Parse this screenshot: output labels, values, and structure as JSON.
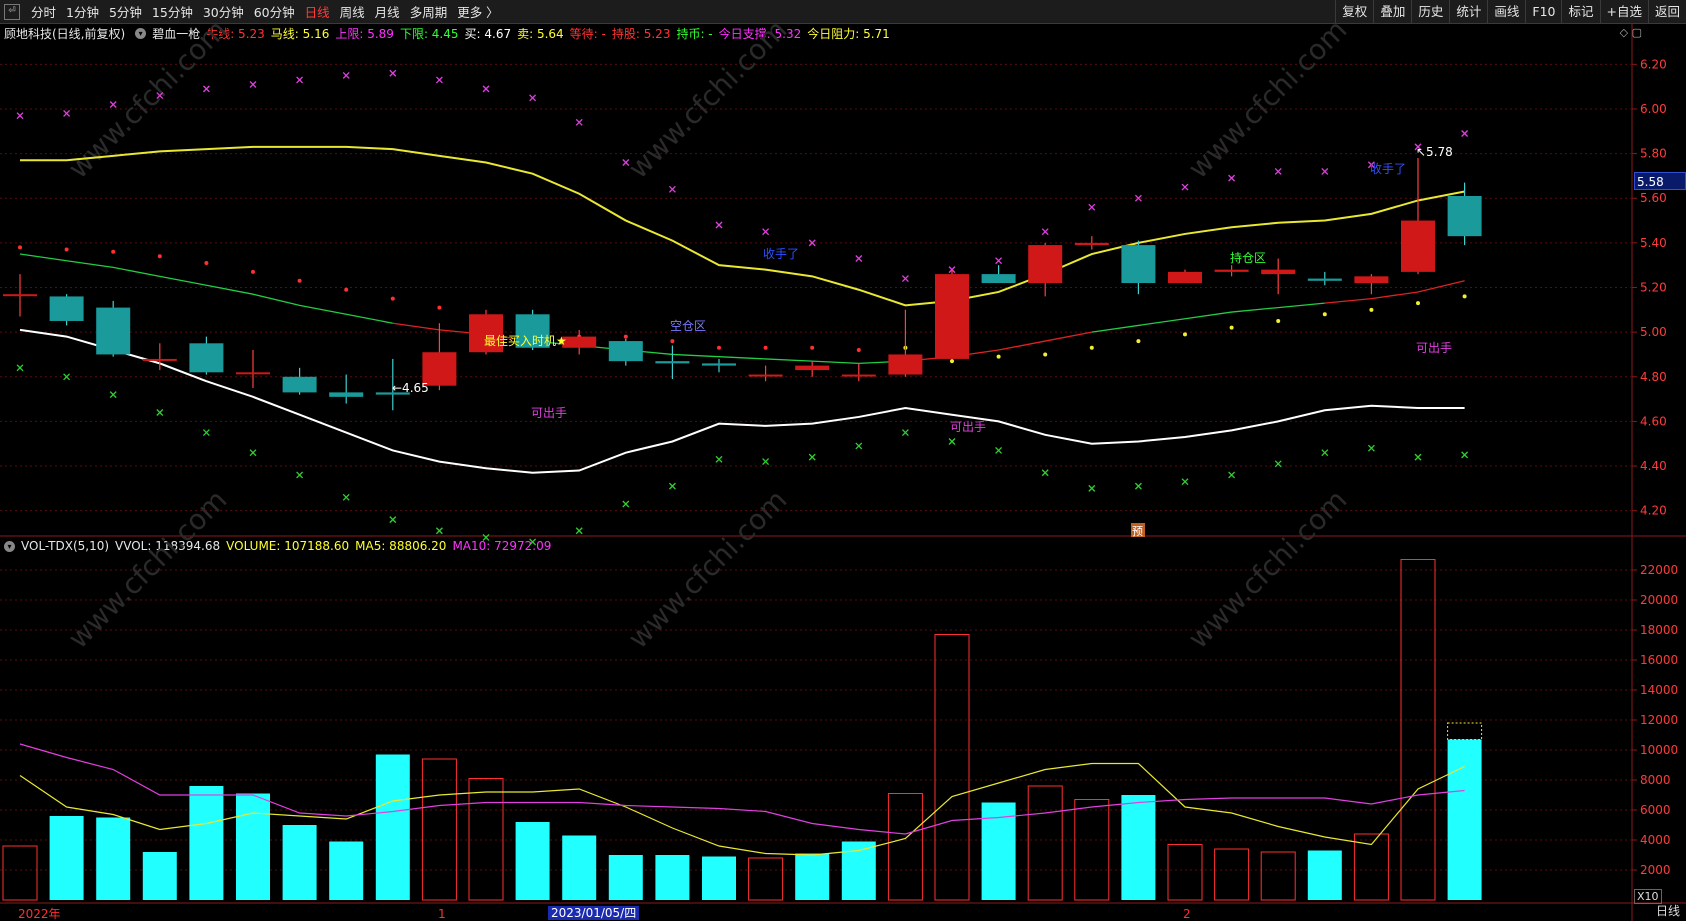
{
  "toolbar": {
    "left_items": [
      "分时",
      "1分钟",
      "5分钟",
      "15分钟",
      "30分钟",
      "60分钟",
      "日线",
      "周线",
      "月线",
      "多周期",
      "更多 〉"
    ],
    "active_index": 6,
    "right_items": [
      "复权",
      "叠加",
      "历史",
      "统计",
      "画线",
      "F10",
      "标记",
      "+自选",
      "返回"
    ]
  },
  "info": {
    "stock": "顾地科技(日线,前复权)",
    "indicator": "碧血一枪",
    "fields": [
      {
        "label": "牛线:",
        "value": "5.23",
        "color": "#ff3333"
      },
      {
        "label": "马线:",
        "value": "5.16",
        "color": "#ffff33"
      },
      {
        "label": "上限:",
        "value": "5.89",
        "color": "#ff33ff"
      },
      {
        "label": "下限:",
        "value": "4.45",
        "color": "#33ff33"
      },
      {
        "label": "买:",
        "value": "4.67",
        "color": "#ffffff"
      },
      {
        "label": "卖:",
        "value": "5.64",
        "color": "#ffff33"
      },
      {
        "label": "等待:",
        "value": "-",
        "color": "#ff3333"
      },
      {
        "label": "持股:",
        "value": "5.23",
        "color": "#ff3333"
      },
      {
        "label": "持币:",
        "value": "-",
        "color": "#33ff33"
      },
      {
        "label": "今日支撑:",
        "value": "5.32",
        "color": "#ff33ff"
      },
      {
        "label": "今日阻力:",
        "value": "5.71",
        "color": "#ffff33"
      }
    ]
  },
  "price_axis": [
    "6.20",
    "6.00",
    "5.80",
    "5.60",
    "5.40",
    "5.20",
    "5.00",
    "4.80",
    "4.60",
    "4.40",
    "4.20"
  ],
  "current_price": "5.58",
  "vol": {
    "name": "VOL-TDX(5,10)",
    "vvol": "VVOL: 118394.68",
    "volume": "VOLUME: 107188.60",
    "ma5": "MA5: 88806.20",
    "ma10": "MA10: 72972.09"
  },
  "vol_axis": [
    "22000",
    "20000",
    "18000",
    "16000",
    "14000",
    "12000",
    "10000",
    "8000",
    "6000",
    "4000",
    "2000"
  ],
  "annotations": {
    "low": "←4.65",
    "high": "↖5.78",
    "best_buy": "最佳买入时机★",
    "sell1": "可出手",
    "sell2": "可出手",
    "sell3": "可出手",
    "empty_zone": "空仓区",
    "hold_zone": "持仓区",
    "take_profit": "收手了",
    "take_profit2": "收手了",
    "yu": "预"
  },
  "x_labels": {
    "year": "2022年",
    "m1": "1",
    "m2": "2",
    "date": "2023/01/05/四"
  },
  "period": "日线",
  "x10": "X10",
  "watermark": "www.cfchi.com",
  "chart_data": {
    "type": "candlestick",
    "title": "顾地科技(日线,前复权)",
    "price_ylim": [
      4.1,
      6.3
    ],
    "candles": [
      {
        "o": 5.17,
        "c": 5.17,
        "h": 5.26,
        "l": 5.07
      },
      {
        "o": 5.16,
        "c": 5.05,
        "h": 5.17,
        "l": 5.03
      },
      {
        "o": 5.11,
        "c": 4.9,
        "h": 5.14,
        "l": 4.89
      },
      {
        "o": 4.88,
        "c": 4.88,
        "h": 4.95,
        "l": 4.83
      },
      {
        "o": 4.95,
        "c": 4.82,
        "h": 4.98,
        "l": 4.81
      },
      {
        "o": 4.82,
        "c": 4.82,
        "h": 4.92,
        "l": 4.75
      },
      {
        "o": 4.8,
        "c": 4.73,
        "h": 4.84,
        "l": 4.72
      },
      {
        "o": 4.73,
        "c": 4.71,
        "h": 4.81,
        "l": 4.68
      },
      {
        "o": 4.73,
        "c": 4.72,
        "h": 4.88,
        "l": 4.65
      },
      {
        "o": 4.76,
        "c": 4.91,
        "h": 5.04,
        "l": 4.74
      },
      {
        "o": 4.91,
        "c": 5.08,
        "h": 5.1,
        "l": 4.9
      },
      {
        "o": 5.08,
        "c": 4.93,
        "h": 5.1,
        "l": 4.92
      },
      {
        "o": 4.93,
        "c": 4.98,
        "h": 5.01,
        "l": 4.9
      },
      {
        "o": 4.96,
        "c": 4.87,
        "h": 4.97,
        "l": 4.85
      },
      {
        "o": 4.87,
        "c": 4.86,
        "h": 4.94,
        "l": 4.79
      },
      {
        "o": 4.86,
        "c": 4.85,
        "h": 4.88,
        "l": 4.82
      },
      {
        "o": 4.81,
        "c": 4.81,
        "h": 4.85,
        "l": 4.78
      },
      {
        "o": 4.83,
        "c": 4.85,
        "h": 4.87,
        "l": 4.8
      },
      {
        "o": 4.81,
        "c": 4.81,
        "h": 4.86,
        "l": 4.78
      },
      {
        "o": 4.81,
        "c": 4.9,
        "h": 5.1,
        "l": 4.8
      },
      {
        "o": 4.88,
        "c": 5.26,
        "h": 5.28,
        "l": 4.88
      },
      {
        "o": 5.26,
        "c": 5.22,
        "h": 5.3,
        "l": 5.22
      },
      {
        "o": 5.22,
        "c": 5.39,
        "h": 5.4,
        "l": 5.16
      },
      {
        "o": 5.39,
        "c": 5.4,
        "h": 5.43,
        "l": 5.37
      },
      {
        "o": 5.39,
        "c": 5.22,
        "h": 5.41,
        "l": 5.17
      },
      {
        "o": 5.22,
        "c": 5.27,
        "h": 5.28,
        "l": 5.22
      },
      {
        "o": 5.27,
        "c": 5.28,
        "h": 5.3,
        "l": 5.25
      },
      {
        "o": 5.26,
        "c": 5.28,
        "h": 5.33,
        "l": 5.17
      },
      {
        "o": 5.24,
        "c": 5.23,
        "h": 5.27,
        "l": 5.21
      },
      {
        "o": 5.22,
        "c": 5.25,
        "h": 5.26,
        "l": 5.17
      },
      {
        "o": 5.27,
        "c": 5.5,
        "h": 5.78,
        "l": 5.26
      },
      {
        "o": 5.61,
        "c": 5.43,
        "h": 5.67,
        "l": 5.39
      }
    ],
    "volume_ylim": [
      0,
      23000
    ],
    "volume": [
      3600,
      5600,
      5500,
      3200,
      7600,
      7100,
      5000,
      3900,
      9700,
      9400,
      8100,
      5200,
      4300,
      3000,
      3000,
      2900,
      2800,
      3100,
      3900,
      7100,
      17700,
      6500,
      7600,
      6700,
      7000,
      3700,
      3400,
      3200,
      3300,
      4400,
      22700,
      10700
    ],
    "volume_up": [
      true,
      false,
      false,
      false,
      false,
      false,
      false,
      false,
      false,
      true,
      true,
      false,
      false,
      false,
      false,
      false,
      true,
      false,
      false,
      true,
      true,
      false,
      true,
      true,
      false,
      true,
      true,
      true,
      false,
      true,
      true,
      false
    ],
    "volume_forecast_top": 11800,
    "series": {
      "upper_yellow": [
        5.77,
        5.77,
        5.79,
        5.81,
        5.82,
        5.83,
        5.83,
        5.83,
        5.82,
        5.79,
        5.76,
        5.71,
        5.62,
        5.5,
        5.41,
        5.3,
        5.28,
        5.25,
        5.19,
        5.12,
        5.14,
        5.18,
        5.26,
        5.35,
        5.4,
        5.44,
        5.47,
        5.49,
        5.5,
        5.53,
        5.59,
        5.63
      ],
      "mid_line": [
        5.35,
        5.32,
        5.29,
        5.25,
        5.21,
        5.17,
        5.12,
        5.08,
        5.04,
        5.01,
        4.99,
        4.96,
        4.94,
        4.92,
        4.9,
        4.89,
        4.88,
        4.87,
        4.86,
        4.87,
        4.89,
        4.92,
        4.96,
        5.0,
        5.03,
        5.06,
        5.09,
        5.11,
        5.13,
        5.15,
        5.18,
        5.23
      ],
      "lower_white": [
        5.01,
        4.98,
        4.92,
        4.86,
        4.78,
        4.71,
        4.63,
        4.55,
        4.47,
        4.42,
        4.39,
        4.37,
        4.38,
        4.46,
        4.51,
        4.59,
        4.58,
        4.59,
        4.62,
        4.66,
        4.63,
        4.6,
        4.54,
        4.5,
        4.51,
        4.53,
        4.56,
        4.6,
        4.65,
        4.67,
        4.66,
        4.66
      ],
      "upper_x": [
        5.97,
        5.98,
        6.02,
        6.06,
        6.09,
        6.11,
        6.13,
        6.15,
        6.16,
        6.13,
        6.09,
        6.05,
        5.94,
        5.76,
        5.64,
        5.48,
        5.45,
        5.4,
        5.33,
        5.24,
        5.28,
        5.32,
        5.45,
        5.56,
        5.6,
        5.65,
        5.69,
        5.72,
        5.72,
        5.75,
        5.83,
        5.89
      ],
      "lower_x": [
        4.84,
        4.8,
        4.72,
        4.64,
        4.55,
        4.46,
        4.36,
        4.26,
        4.16,
        4.11,
        4.08,
        4.06,
        4.11,
        4.23,
        4.31,
        4.43,
        4.42,
        4.44,
        4.49,
        4.55,
        4.51,
        4.47,
        4.37,
        4.3,
        4.31,
        4.33,
        4.36,
        4.41,
        4.46,
        4.48,
        4.44,
        4.45
      ],
      "dots": [
        5.38,
        5.37,
        5.36,
        5.34,
        5.31,
        5.27,
        5.23,
        5.19,
        5.15,
        5.11,
        5.07,
        5.02,
        4.98,
        4.98,
        4.96,
        4.93,
        4.93,
        4.93,
        4.92,
        4.93,
        4.87,
        4.89,
        4.9,
        4.93,
        4.96,
        4.99,
        5.02,
        5.05,
        5.08,
        5.1,
        5.13,
        5.16
      ],
      "vol_ma5": [
        8300,
        6200,
        5700,
        4700,
        5100,
        5800,
        5600,
        5400,
        6600,
        7000,
        7200,
        7200,
        7400,
        6200,
        4800,
        3600,
        3100,
        3000,
        3300,
        4100,
        6900,
        7800,
        8700,
        9100,
        9100,
        6200,
        5800,
        4900,
        4200,
        3700,
        7400,
        8900
      ],
      "vol_ma10": [
        10400,
        9500,
        8700,
        7000,
        7000,
        7000,
        5800,
        5600,
        5900,
        6300,
        6500,
        6500,
        6500,
        6300,
        6200,
        6100,
        5900,
        5100,
        4700,
        4400,
        5300,
        5500,
        5800,
        6200,
        6500,
        6700,
        6800,
        6800,
        6800,
        6400,
        7000,
        7300
      ]
    }
  }
}
